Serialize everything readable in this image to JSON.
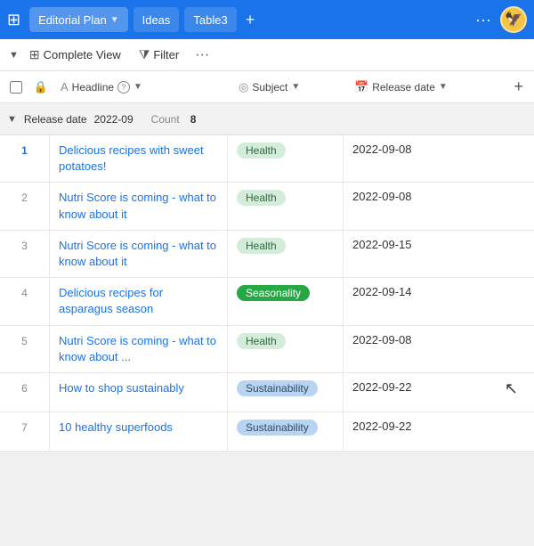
{
  "topbar": {
    "tabs": [
      {
        "id": "editorial-plan",
        "label": "Editorial Plan",
        "active": true,
        "hasDropdown": true
      },
      {
        "id": "ideas",
        "label": "Ideas",
        "active": false,
        "hasDropdown": false
      },
      {
        "id": "table3",
        "label": "Table3",
        "active": false,
        "hasDropdown": false
      }
    ],
    "add_tab_label": "+",
    "more_label": "···"
  },
  "toolbar": {
    "view_label": "Complete View",
    "filter_label": "Filter",
    "more_label": "···"
  },
  "columns": {
    "headline_label": "Headline",
    "subject_label": "Subject",
    "release_date_label": "Release date",
    "add_col_label": "+"
  },
  "group": {
    "label": "Release date",
    "value": "2022-09",
    "count_label": "Count",
    "count_value": "8"
  },
  "rows": [
    {
      "num": "1",
      "headline": "Delicious recipes with sweet potatoes!",
      "subject": "Health",
      "subject_type": "health",
      "release": "2022-09-08",
      "active": true
    },
    {
      "num": "2",
      "headline": "Nutri Score is coming - what to know about it",
      "subject": "Health",
      "subject_type": "health",
      "release": "2022-09-08",
      "active": false
    },
    {
      "num": "3",
      "headline": "Nutri Score is coming - what to know about it",
      "subject": "Health",
      "subject_type": "health",
      "release": "2022-09-15",
      "active": false
    },
    {
      "num": "4",
      "headline": "Delicious recipes for asparagus season",
      "subject": "Seasonality",
      "subject_type": "seasonality",
      "release": "2022-09-14",
      "active": false
    },
    {
      "num": "5",
      "headline": "Nutri Score is coming - what to know about ...",
      "subject": "Health",
      "subject_type": "health",
      "release": "2022-09-08",
      "active": false
    },
    {
      "num": "6",
      "headline": "How to shop sustainably",
      "subject": "Sustainability",
      "subject_type": "sustainability",
      "release": "2022-09-22",
      "active": false
    },
    {
      "num": "7",
      "headline": "10 healthy superfoods",
      "subject": "Sustainability",
      "subject_type": "sustainability",
      "release": "2022-09-22",
      "active": false
    }
  ]
}
